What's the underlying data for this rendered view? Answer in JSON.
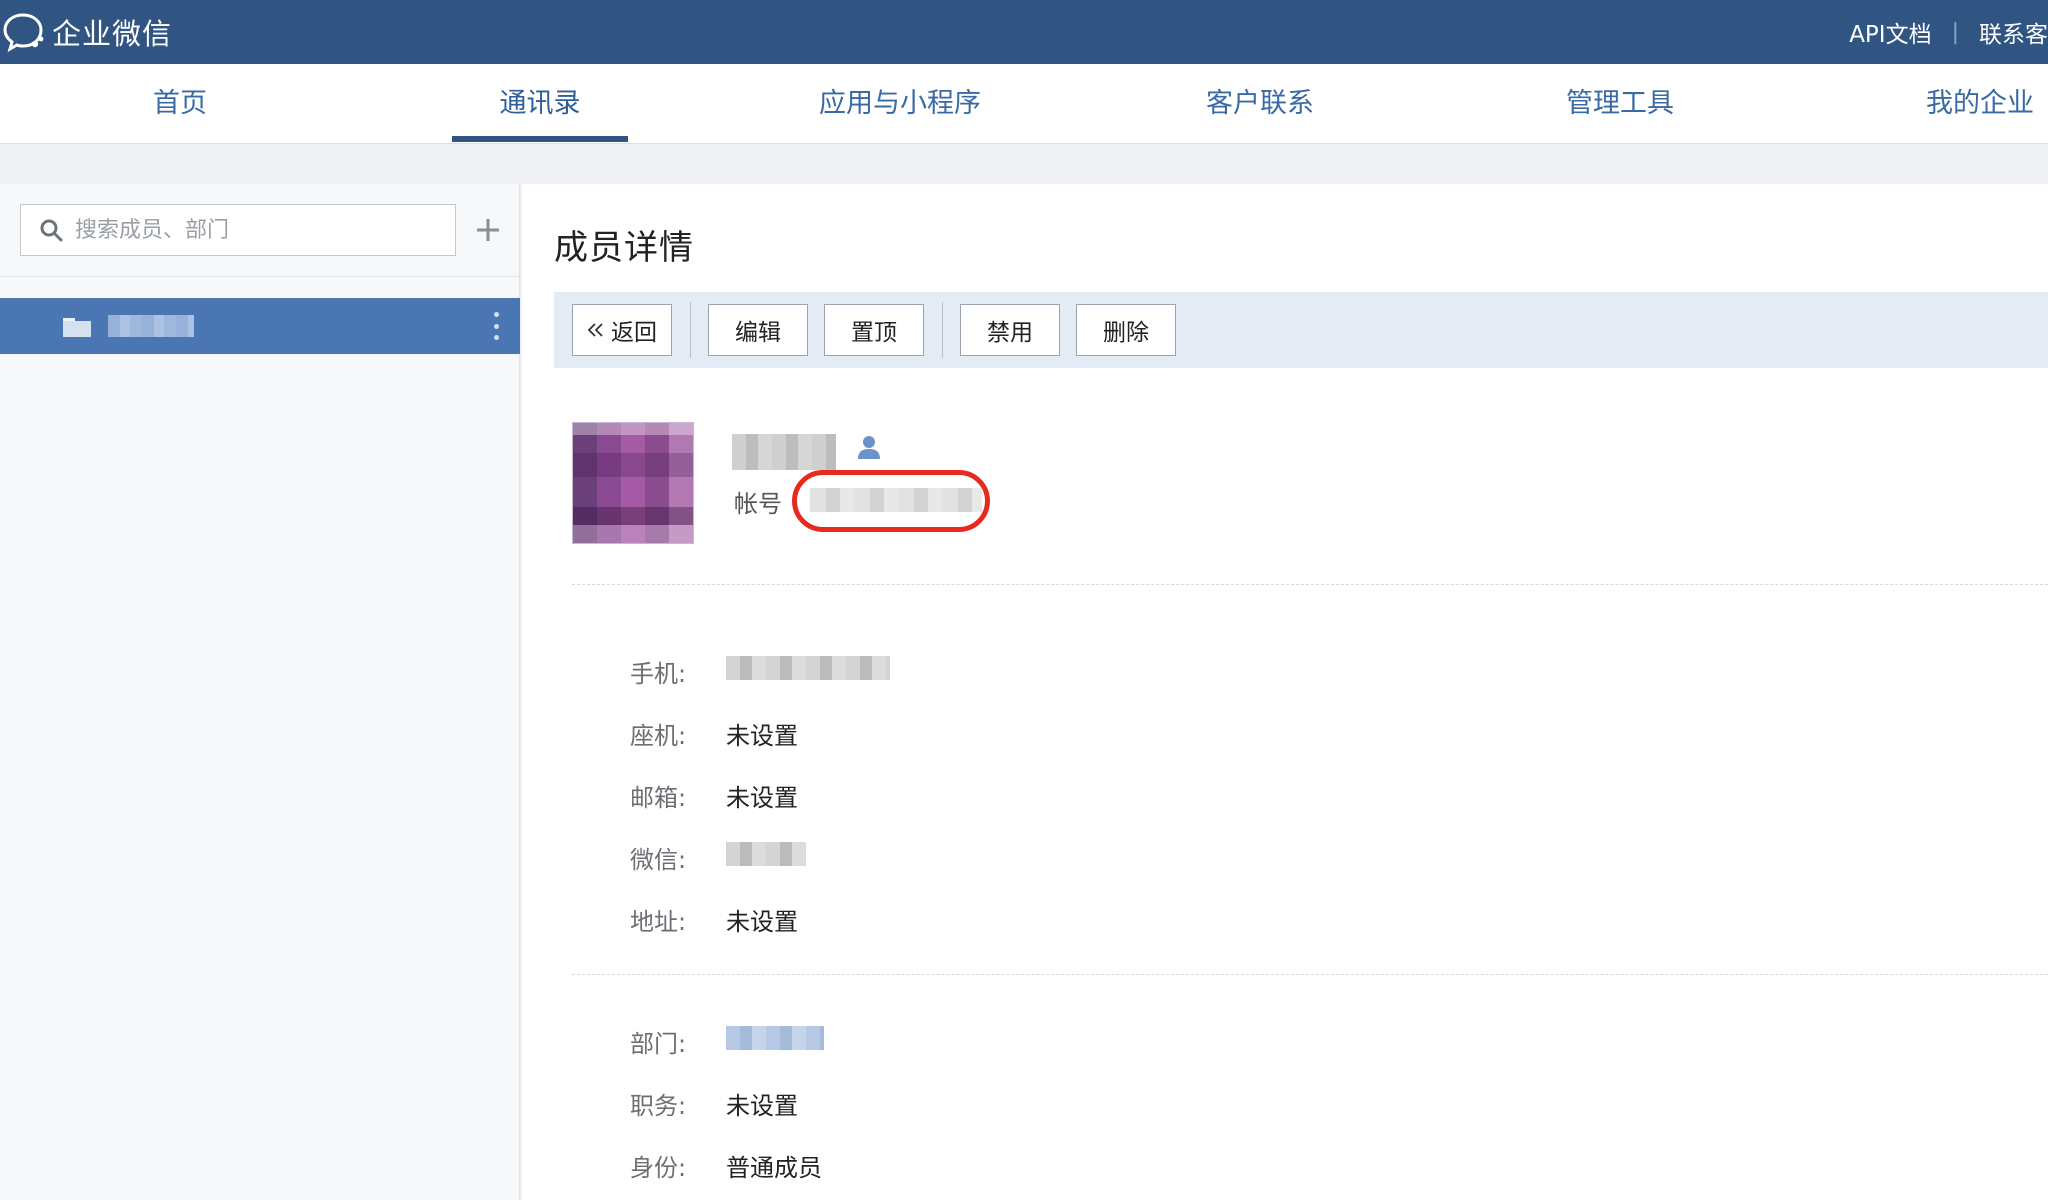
{
  "header": {
    "logo_text": "企业微信",
    "links": [
      "API文档",
      "联系客"
    ]
  },
  "nav": {
    "tabs": [
      {
        "label": "首页",
        "active": false
      },
      {
        "label": "通讯录",
        "active": true
      },
      {
        "label": "应用与小程序",
        "active": false
      },
      {
        "label": "客户联系",
        "active": false
      },
      {
        "label": "管理工具",
        "active": false
      },
      {
        "label": "我的企业",
        "active": false
      }
    ]
  },
  "sidebar": {
    "search_placeholder": "搜索成员、部门",
    "add_icon": "plus-icon",
    "selected_department": {
      "icon": "folder-icon",
      "more_icon": "vertical-dots-icon"
    }
  },
  "main": {
    "title": "成员详情",
    "toolbar": {
      "back": "返回",
      "back_icon": "double-chevron-left-icon",
      "edit": "编辑",
      "pin": "置顶",
      "disable": "禁用",
      "delete": "删除"
    },
    "member": {
      "account_label": "帐号",
      "member_icon": "person-icon"
    },
    "contact_fields": [
      {
        "label": "手机:",
        "value": ""
      },
      {
        "label": "座机:",
        "value": "未设置"
      },
      {
        "label": "邮箱:",
        "value": "未设置"
      },
      {
        "label": "微信:",
        "value": ""
      },
      {
        "label": "地址:",
        "value": "未设置"
      }
    ],
    "org_fields": [
      {
        "label": "部门:",
        "value": ""
      },
      {
        "label": "职务:",
        "value": "未设置"
      },
      {
        "label": "身份:",
        "value": "普通成员"
      }
    ]
  },
  "colors": {
    "topbar": "#315582",
    "accent": "#2f5583",
    "selected_row": "#4a77b3",
    "toolbar_bg": "#e4ebf4",
    "highlight_circle": "#e8291e"
  }
}
